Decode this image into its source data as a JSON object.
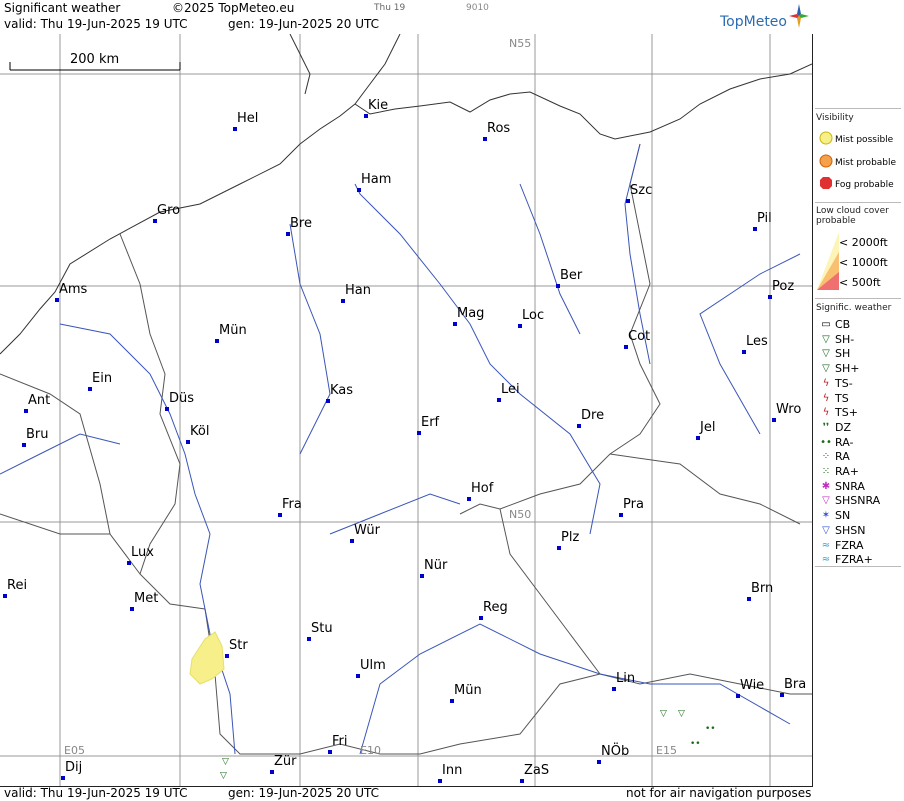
{
  "header": {
    "title": "Significant weather",
    "copyright": "©2025 TopMeteo.eu",
    "day": "Thu 19",
    "code": "9010",
    "valid": "valid:  Thu  19-Jun-2025  19 UTC",
    "gen": "gen: 19-Jun-2025 20 UTC",
    "brand": "TopMeteo"
  },
  "footer": {
    "valid": "valid:  Thu  19-Jun-2025  19 UTC",
    "gen": "gen: 19-Jun-2025 20 UTC",
    "disclaimer": "not for air navigation purposes"
  },
  "map": {
    "scale_label": "200 km",
    "grid_labels": {
      "n55": "N55",
      "n50": "N50",
      "e05": "E05",
      "e10": "E10",
      "e15": "E15"
    },
    "cities": [
      {
        "name": "Kie"
      },
      {
        "name": "Hel"
      },
      {
        "name": "Ros"
      },
      {
        "name": "Ham"
      },
      {
        "name": "Szc"
      },
      {
        "name": "Gro"
      },
      {
        "name": "Bre"
      },
      {
        "name": "Pil"
      },
      {
        "name": "Ber"
      },
      {
        "name": "Ams"
      },
      {
        "name": "Han"
      },
      {
        "name": "Poz"
      },
      {
        "name": "Mag"
      },
      {
        "name": "Loc"
      },
      {
        "name": "Mün"
      },
      {
        "name": "Cot"
      },
      {
        "name": "Les"
      },
      {
        "name": "Ein"
      },
      {
        "name": "Kas"
      },
      {
        "name": "Lei"
      },
      {
        "name": "Ant"
      },
      {
        "name": "Düs"
      },
      {
        "name": "Wro"
      },
      {
        "name": "Dre"
      },
      {
        "name": "Erf"
      },
      {
        "name": "Bru"
      },
      {
        "name": "Köl"
      },
      {
        "name": "Jel"
      },
      {
        "name": "Hof"
      },
      {
        "name": "Fra"
      },
      {
        "name": "Pra"
      },
      {
        "name": "Wür"
      },
      {
        "name": "Lux"
      },
      {
        "name": "Plz"
      },
      {
        "name": "Nür"
      },
      {
        "name": "Rei"
      },
      {
        "name": "Brn"
      },
      {
        "name": "Met"
      },
      {
        "name": "Reg"
      },
      {
        "name": "Stu"
      },
      {
        "name": "Str"
      },
      {
        "name": "Lin"
      },
      {
        "name": "Ulm"
      },
      {
        "name": "Wie"
      },
      {
        "name": "Bra"
      },
      {
        "name": "Mün"
      },
      {
        "name": "Fri"
      },
      {
        "name": "NÖb"
      },
      {
        "name": "Dij"
      },
      {
        "name": "Zür"
      },
      {
        "name": "Inn"
      },
      {
        "name": "ZaS"
      }
    ]
  },
  "legend": {
    "visibility_title": "Visibility",
    "visibility": [
      "Mist possible",
      "Mist probable",
      "Fog probable"
    ],
    "lowcloud_title": "Low cloud cover probable",
    "lowcloud": [
      "< 2000ft",
      "< 1000ft",
      "<   500ft"
    ],
    "sigwx_title": "Signific. weather",
    "sigwx": [
      "CB",
      "SH-",
      "SH",
      "SH+",
      "TS-",
      "TS",
      "TS+",
      "DZ",
      "RA-",
      "RA",
      "RA+",
      "SNRA",
      "SHSNRA",
      "SN",
      "SHSN",
      "FZRA",
      "FZRA+"
    ],
    "colors": {
      "mist_possible": "#f7f08a",
      "mist_probable": "#f5a04a",
      "fog_probable": "#e03030",
      "city_dot": "#0000cc",
      "rain": "#1b6b1b"
    }
  }
}
